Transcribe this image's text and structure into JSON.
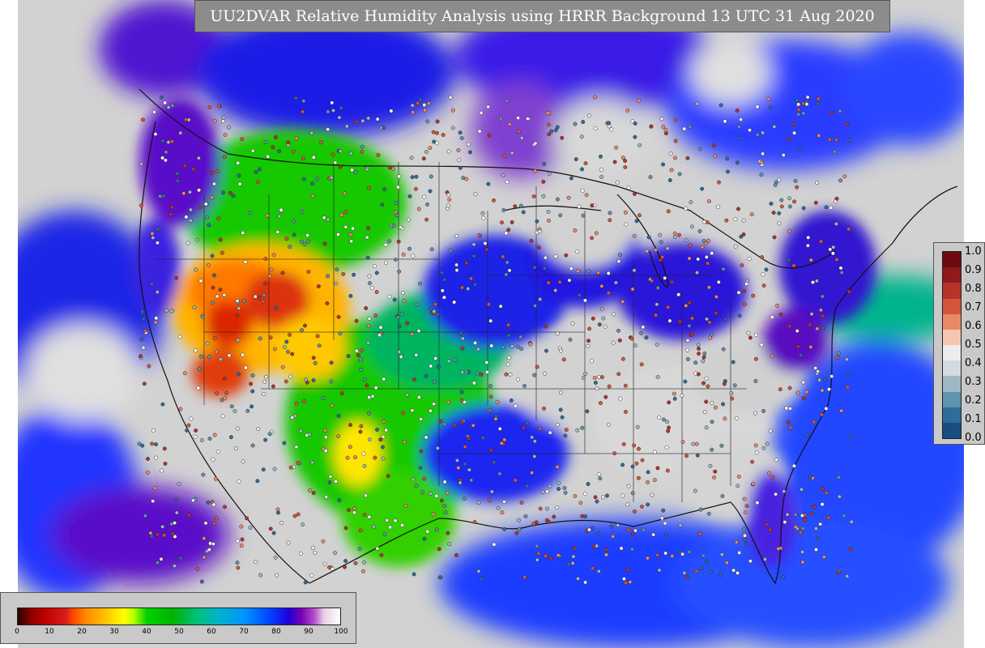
{
  "title": "UU2DVAR Relative Humidity Analysis using HRRR Background 13 UTC 31 Aug 2020",
  "ratio_colorbar": {
    "ticks": [
      "1.0",
      "0.9",
      "0.8",
      "0.7",
      "0.6",
      "0.5",
      "0.4",
      "0.3",
      "0.2",
      "0.1",
      "0.0"
    ],
    "colors": [
      "#6e0a12",
      "#8e1a1e",
      "#b5332a",
      "#d4553a",
      "#e88a68",
      "#f4c6b0",
      "#ececec",
      "#d2dbe0",
      "#9fb8c4",
      "#5f93ae",
      "#2f6c99",
      "#1a4d7f"
    ]
  },
  "rh_colorbar": {
    "ticks": [
      "0",
      "10",
      "20",
      "30",
      "40",
      "50",
      "60",
      "70",
      "80",
      "90",
      "100"
    ]
  },
  "colors": {
    "ocean": "#1a3cff",
    "land_dry_red": "#c81e1e",
    "land_orange": "#ff8c00",
    "land_yellow": "#ffe600",
    "land_green": "#18c800",
    "land_blue": "#0a1ee6",
    "moist_purple": "#6a0dad",
    "saturated_gray": "#d4d4d4"
  }
}
